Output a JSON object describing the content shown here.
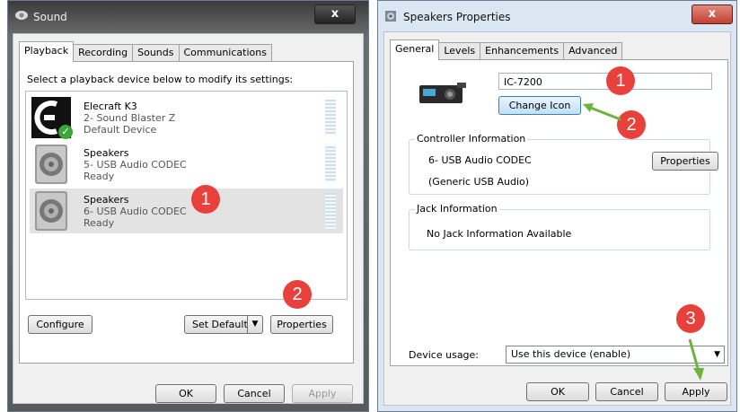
{
  "sound_window": {
    "title": "Sound",
    "close_glyph": "x",
    "tabs": [
      "Playback",
      "Recording",
      "Sounds",
      "Communications"
    ],
    "instruction": "Select a playback device below to modify its settings:",
    "devices": [
      {
        "name": "Elecraft K3",
        "line1": "2- Sound Blaster Z",
        "line2": "Default Device",
        "icon": "elecraft-icon",
        "default": true,
        "selected": false
      },
      {
        "name": "Speakers",
        "line1": "5- USB Audio CODEC",
        "line2": "Ready",
        "icon": "speaker-icon",
        "default": false,
        "selected": false
      },
      {
        "name": "Speakers",
        "line1": "6- USB Audio CODEC",
        "line2": "Ready",
        "icon": "speaker-icon",
        "default": false,
        "selected": true
      }
    ],
    "configure_label": "Configure",
    "set_default_label": "Set Default",
    "properties_label": "Properties",
    "ok_label": "OK",
    "cancel_label": "Cancel",
    "apply_label": "Apply",
    "callouts": [
      "1",
      "2"
    ]
  },
  "speakers_window": {
    "title": "Speakers Properties",
    "close_glyph": "x",
    "tabs": [
      "General",
      "Levels",
      "Enhancements",
      "Advanced"
    ],
    "device_name_value": "IC-7200",
    "change_icon_label": "Change Icon",
    "controller_group_label": "Controller Information",
    "controller_name": "6- USB Audio CODEC",
    "controller_driver": "(Generic USB Audio)",
    "controller_properties_label": "Properties",
    "jack_group_label": "Jack Information",
    "jack_text": "No Jack Information Available",
    "device_usage_label": "Device usage:",
    "device_usage_value": "Use this device (enable)",
    "ok_label": "OK",
    "cancel_label": "Cancel",
    "apply_label": "Apply",
    "callouts": [
      "1",
      "2",
      "3"
    ]
  },
  "colors": {
    "callout": "#e8403a",
    "arrow": "#6db33f",
    "close": "#c9453e",
    "title_bar": "#dbe6f3"
  }
}
